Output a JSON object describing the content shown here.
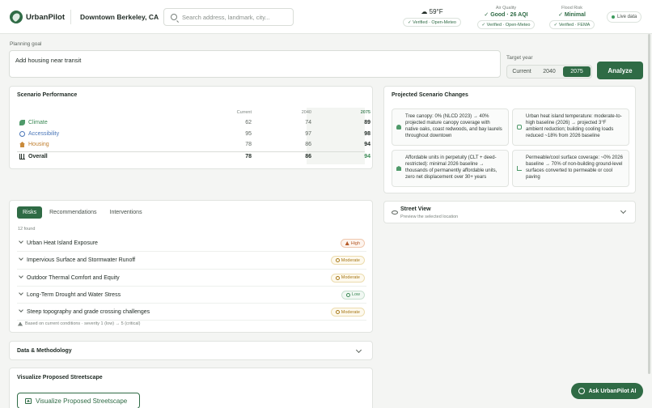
{
  "header": {
    "app_name": "UrbanPilot",
    "location": "Downtown Berkeley, CA",
    "search_placeholder": "Search address, landmark, city...",
    "weather": {
      "value": "59°F",
      "chip": "Verified · Open-Meteo"
    },
    "air_quality": {
      "label": "Air Quality",
      "value": "Good · 26 AQI",
      "chip": "Verified · Open-Meteo"
    },
    "flood_risk": {
      "label": "Flood Risk",
      "value": "Minimal",
      "chip": "Verified · FEMA"
    },
    "live": "Live data"
  },
  "goal": {
    "label": "Planning goal",
    "value": "Add housing near transit",
    "target_label": "Target year",
    "years": [
      "Current",
      "2040",
      "2075"
    ],
    "active_year": "2075",
    "analyze": "Analyze"
  },
  "performance": {
    "title": "Scenario Performance",
    "columns": [
      "Current",
      "2040",
      "2075"
    ],
    "rows": [
      {
        "name": "Climate",
        "icon": "leaf-icon",
        "current": "62",
        "y2040": "74",
        "y2075": "89"
      },
      {
        "name": "Accessibility",
        "icon": "accessibility-icon",
        "current": "95",
        "y2040": "97",
        "y2075": "98"
      },
      {
        "name": "Housing",
        "icon": "house-icon",
        "current": "78",
        "y2040": "86",
        "y2075": "94"
      }
    ],
    "overall": {
      "name": "Overall",
      "icon": "bar-chart-icon",
      "current": "78",
      "y2040": "86",
      "y2075": "94"
    }
  },
  "projected": {
    "title": "Projected Scenario Changes",
    "items": [
      "Tree canopy: 0% (NLCD 2023) → 40% projected mature canopy coverage with native oaks, coast redwoods, and bay laurels throughout downtown",
      "Urban heat island temperature: moderate-to-high baseline (2026) → projected 3°F ambient reduction; building cooling loads reduced ~18% from 2026 baseline",
      "Affordable units in perpetuity (CLT + deed-restricted): minimal 2026 baseline → thousands of permanently affordable units, zero net displacement over 30+ years",
      "Permeable/cool surface coverage: ~0% 2026 baseline → 70% of non-building ground-level surfaces converted to permeable or cool paving"
    ]
  },
  "street_view": {
    "title": "Street View",
    "subtitle": "Preview the selected location"
  },
  "risks": {
    "tabs": [
      "Risks",
      "Recommendations",
      "Interventions"
    ],
    "found": "12 found",
    "items": [
      {
        "name": "Urban Heat Island Exposure",
        "level": "High"
      },
      {
        "name": "Impervious Surface and Stormwater Runoff",
        "level": "Moderate"
      },
      {
        "name": "Outdoor Thermal Comfort and Equity",
        "level": "Moderate"
      },
      {
        "name": "Long-Term Drought and Water Stress",
        "level": "Low"
      },
      {
        "name": "Steep topography and grade crossing challenges",
        "level": "Moderate"
      }
    ],
    "note": "Based on current conditions · severity 1 (low) → 5 (critical)"
  },
  "methodology": {
    "title": "Data & Methodology"
  },
  "visualize": {
    "title": "Visualize Proposed Streetscape",
    "button": "Visualize Proposed Streetscape"
  },
  "ask": "Ask UrbanPilot AI"
}
